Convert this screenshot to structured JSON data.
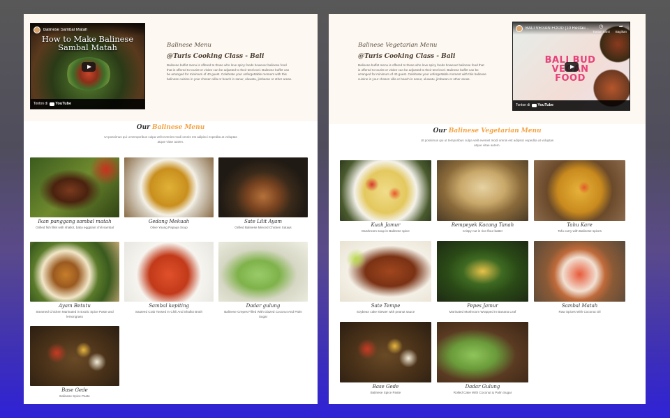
{
  "left_page": {
    "video": {
      "channel_title": "Balinese Sambal Matah",
      "overlay_title": "How to Make Balinese Sambal Matah",
      "watch_on": "Tonton di",
      "youtube": "YouTube"
    },
    "hero": {
      "subtitle": "Balinese Menu",
      "title": "@Turis Cooking Class - Bali",
      "description": "Balinese buffet menu is offered to those who love spicy foods however balinese food that is offered to tourist or visitor can be adjusted to their test level. Balinese buffet can be arranged for minimum of 40 guest. Celebrate your unforgettable moment with this balinese cuisine in your chosen villa or beach in sanur, uluwatu, jimbaran or other areas."
    },
    "menu": {
      "heading_prefix": "Our",
      "heading_accent": "Balinese Menu",
      "intro": "Ut possimus qui ut temporibus culpa velit eveniet modi omnis est adipisci expedita at voluptas atque vitae autem."
    },
    "items": [
      {
        "name": "Ikan panggang sambal matah",
        "desc": "Grilled fish fillet with shallot, baby eggplant chili sambal",
        "icon": "grilled-fish"
      },
      {
        "name": "Gedang Mekuah",
        "desc": "Olive Young Papaya Soup",
        "icon": "papaya-soup"
      },
      {
        "name": "Sate Lilit Ayam",
        "desc": "Grilled Balinese Minced Chicken Satays",
        "icon": "satay-lilit"
      },
      {
        "name": "Ayam Betutu",
        "desc": "Steamed Chicken Marinated in Exotic Spice Paste and lemongrass",
        "icon": "ayam-betutu"
      },
      {
        "name": "Sambal kepiting",
        "desc": "Sauteed Crab Tossed In Chili And Shallot Broth",
        "icon": "chili-crab"
      },
      {
        "name": "Dadar gulung",
        "desc": "Balinese Crepes Filled With Glazed Coconut And Palm Sugar",
        "icon": "green-crepes"
      },
      {
        "name": "Base Gede",
        "desc": "Balinese Spice Paste",
        "icon": "spice-tray"
      }
    ]
  },
  "right_page": {
    "video": {
      "channel_title": "BALI VEGAN FOOD (10 Restau...",
      "action_later": "Tonton nanti",
      "action_share": "Bagikan",
      "overlay_big": "BALI BUD VEGAN FOOD",
      "watch_on": "Tonton di",
      "youtube": "YouTube"
    },
    "hero": {
      "subtitle": "Balinese Vegetarian Menu",
      "title": "@Turis Cooking Class - Bali",
      "description": "Balinese buffet menu is offered to those who love spicy foods however balinese food that is offered to tourist or visitor can be adjusted to their test level. Balinese buffet can be arranged for minimum of 40 guest. Celebrate your unforgettable moment with this balinese cuisine in your chosen villa or beach in sanur, uluwatu, jimbaran or other areas."
    },
    "menu": {
      "heading_prefix": "Our",
      "heading_accent": "Balinese Vegetarian Menu",
      "intro": "Ut possimus qui ut temporibus culpa velit eveniet modi omnis est adipisci expedita at voluptas atque vitae autem."
    },
    "items": [
      {
        "name": "Kuah Jamur",
        "desc": "Mushroom soup in Balinese spice",
        "icon": "mushroom-soup"
      },
      {
        "name": "Rempeyek Kacang Tanah",
        "desc": "Crispy nut in rice flour batter",
        "icon": "peanut-crackers"
      },
      {
        "name": "Tahu Kare",
        "desc": "Tofu curry with Balinese spices",
        "icon": "tofu-curry"
      },
      {
        "name": "Sate Tempe",
        "desc": "Soybean cake skewer with peanut sauce",
        "icon": "tempe-satay"
      },
      {
        "name": "Pepes Jamur",
        "desc": "Marinated Mushroom Wrapped In Banana Leaf",
        "icon": "pepes"
      },
      {
        "name": "Sambal Matah",
        "desc": "Raw Spices With Coconut Oil",
        "icon": "sambal-matah"
      },
      {
        "name": "Base Gede",
        "desc": "Balinese Spice Paste",
        "icon": "spice-tray"
      },
      {
        "name": "Dadar Gulung",
        "desc": "Rolled Cake With Coconut & Palm Sugar",
        "icon": "green-crepes"
      }
    ]
  }
}
